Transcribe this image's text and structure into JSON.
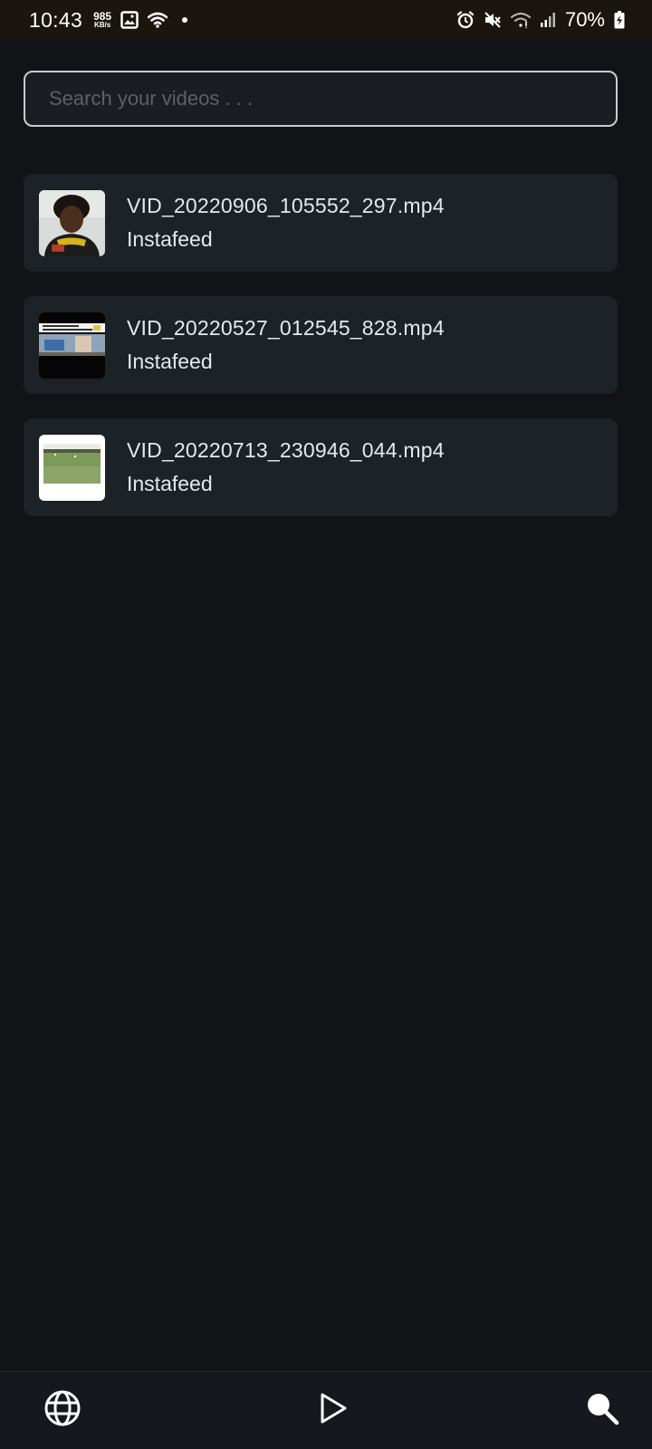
{
  "status_bar": {
    "time": "10:43",
    "net_speed_value": "985",
    "net_speed_unit": "KB/s",
    "battery": "70%",
    "icons": [
      "image-icon",
      "wifi-icon",
      "notification-dot-icon",
      "alarm-icon",
      "mute-icon",
      "wifi-calling-icon",
      "signal-icon",
      "battery-charging-icon"
    ]
  },
  "search": {
    "placeholder": "Search your videos . . ."
  },
  "videos": [
    {
      "title": "VID_20220906_105552_297.mp4",
      "source": "Instafeed",
      "thumbnail": "person-portrait-thumbnail"
    },
    {
      "title": "VID_20220527_012545_828.mp4",
      "source": "Instafeed",
      "thumbnail": "screenshot-thumbnail"
    },
    {
      "title": "VID_20220713_230946_044.mp4",
      "source": "Instafeed",
      "thumbnail": "field-thumbnail"
    }
  ],
  "bottom_nav": {
    "items": [
      "globe-icon",
      "play-icon",
      "search-icon"
    ]
  },
  "colors": {
    "background": "#111317",
    "card": "#1c2226",
    "status_bar": "#1b150f",
    "text": "#e6e9ec"
  }
}
